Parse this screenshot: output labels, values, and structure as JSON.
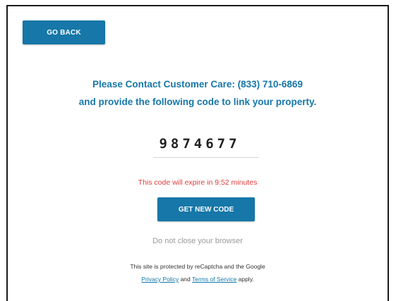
{
  "actions": {
    "go_back_label": "GO BACK",
    "get_new_code_label": "GET NEW CODE"
  },
  "message": {
    "line1": "Please Contact Customer Care: (833) 710-6869",
    "line2": "and provide the following code to link your property."
  },
  "code": {
    "value": "9874677",
    "expiry_text": "This code will expire in 9:52 minutes"
  },
  "notice": {
    "do_not_close": "Do not close your browser"
  },
  "recaptcha": {
    "line1": "This site is protected by reCaptcha and the Google",
    "privacy_link": "Privacy Policy",
    "and_text": " and ",
    "terms_link": "Terms of Service",
    "apply_text": " apply."
  },
  "colors": {
    "primary": "#1677a8",
    "expiry": "#e23b3b",
    "muted": "#9a9a9a"
  }
}
